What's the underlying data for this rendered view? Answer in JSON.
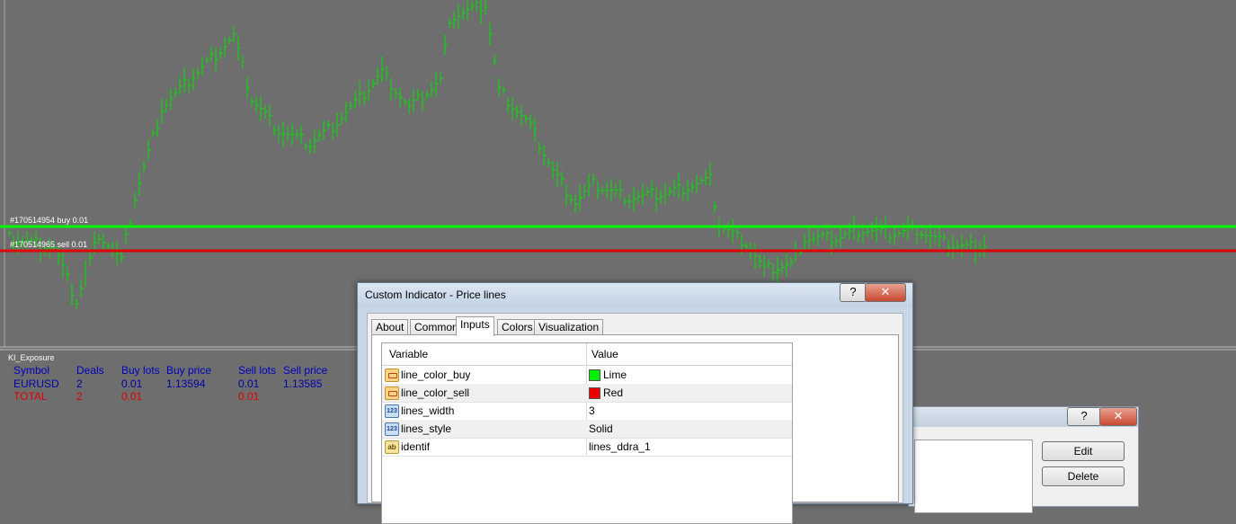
{
  "chart": {
    "buy_line_color": "#00ff00",
    "sell_line_color": "#e00000",
    "buy_line_label": "#170514954 buy 0.01",
    "sell_line_label": "#170514965 sell 0.01",
    "subwindow_label": "KI_Exposure"
  },
  "exposure": {
    "headers": [
      "Symbol",
      "Deals",
      "Buy lots",
      "Buy price",
      "Sell lots",
      "Sell price"
    ],
    "row": [
      "EURUSD",
      "2",
      "0.01",
      "1.13594",
      "0.01",
      "1.13585"
    ],
    "total": [
      "TOTAL",
      "2",
      "0.01",
      "",
      "0.01",
      ""
    ]
  },
  "dialog": {
    "title": "Custom Indicator - Price lines",
    "tabs": [
      "About",
      "Common",
      "Inputs",
      "Colors",
      "Visualization"
    ],
    "active_tab": "Inputs",
    "columns": [
      "Variable",
      "Value"
    ],
    "params": [
      {
        "name": "line_color_buy",
        "value": "Lime",
        "type": "color-icon",
        "swatch": "#00ee00"
      },
      {
        "name": "line_color_sell",
        "value": "Red",
        "type": "color-icon",
        "swatch": "#ee0000"
      },
      {
        "name": "lines_width",
        "value": "3",
        "type": "number-icon"
      },
      {
        "name": "lines_style",
        "value": "Solid",
        "type": "number-icon"
      },
      {
        "name": "identif",
        "value": "lines_ddra_1",
        "type": "string-icon"
      }
    ],
    "help_glyph": "?",
    "close_glyph": "✕"
  },
  "bg_window": {
    "edit_label": "Edit",
    "delete_label": "Delete",
    "help_glyph": "?",
    "close_glyph": "✕"
  }
}
